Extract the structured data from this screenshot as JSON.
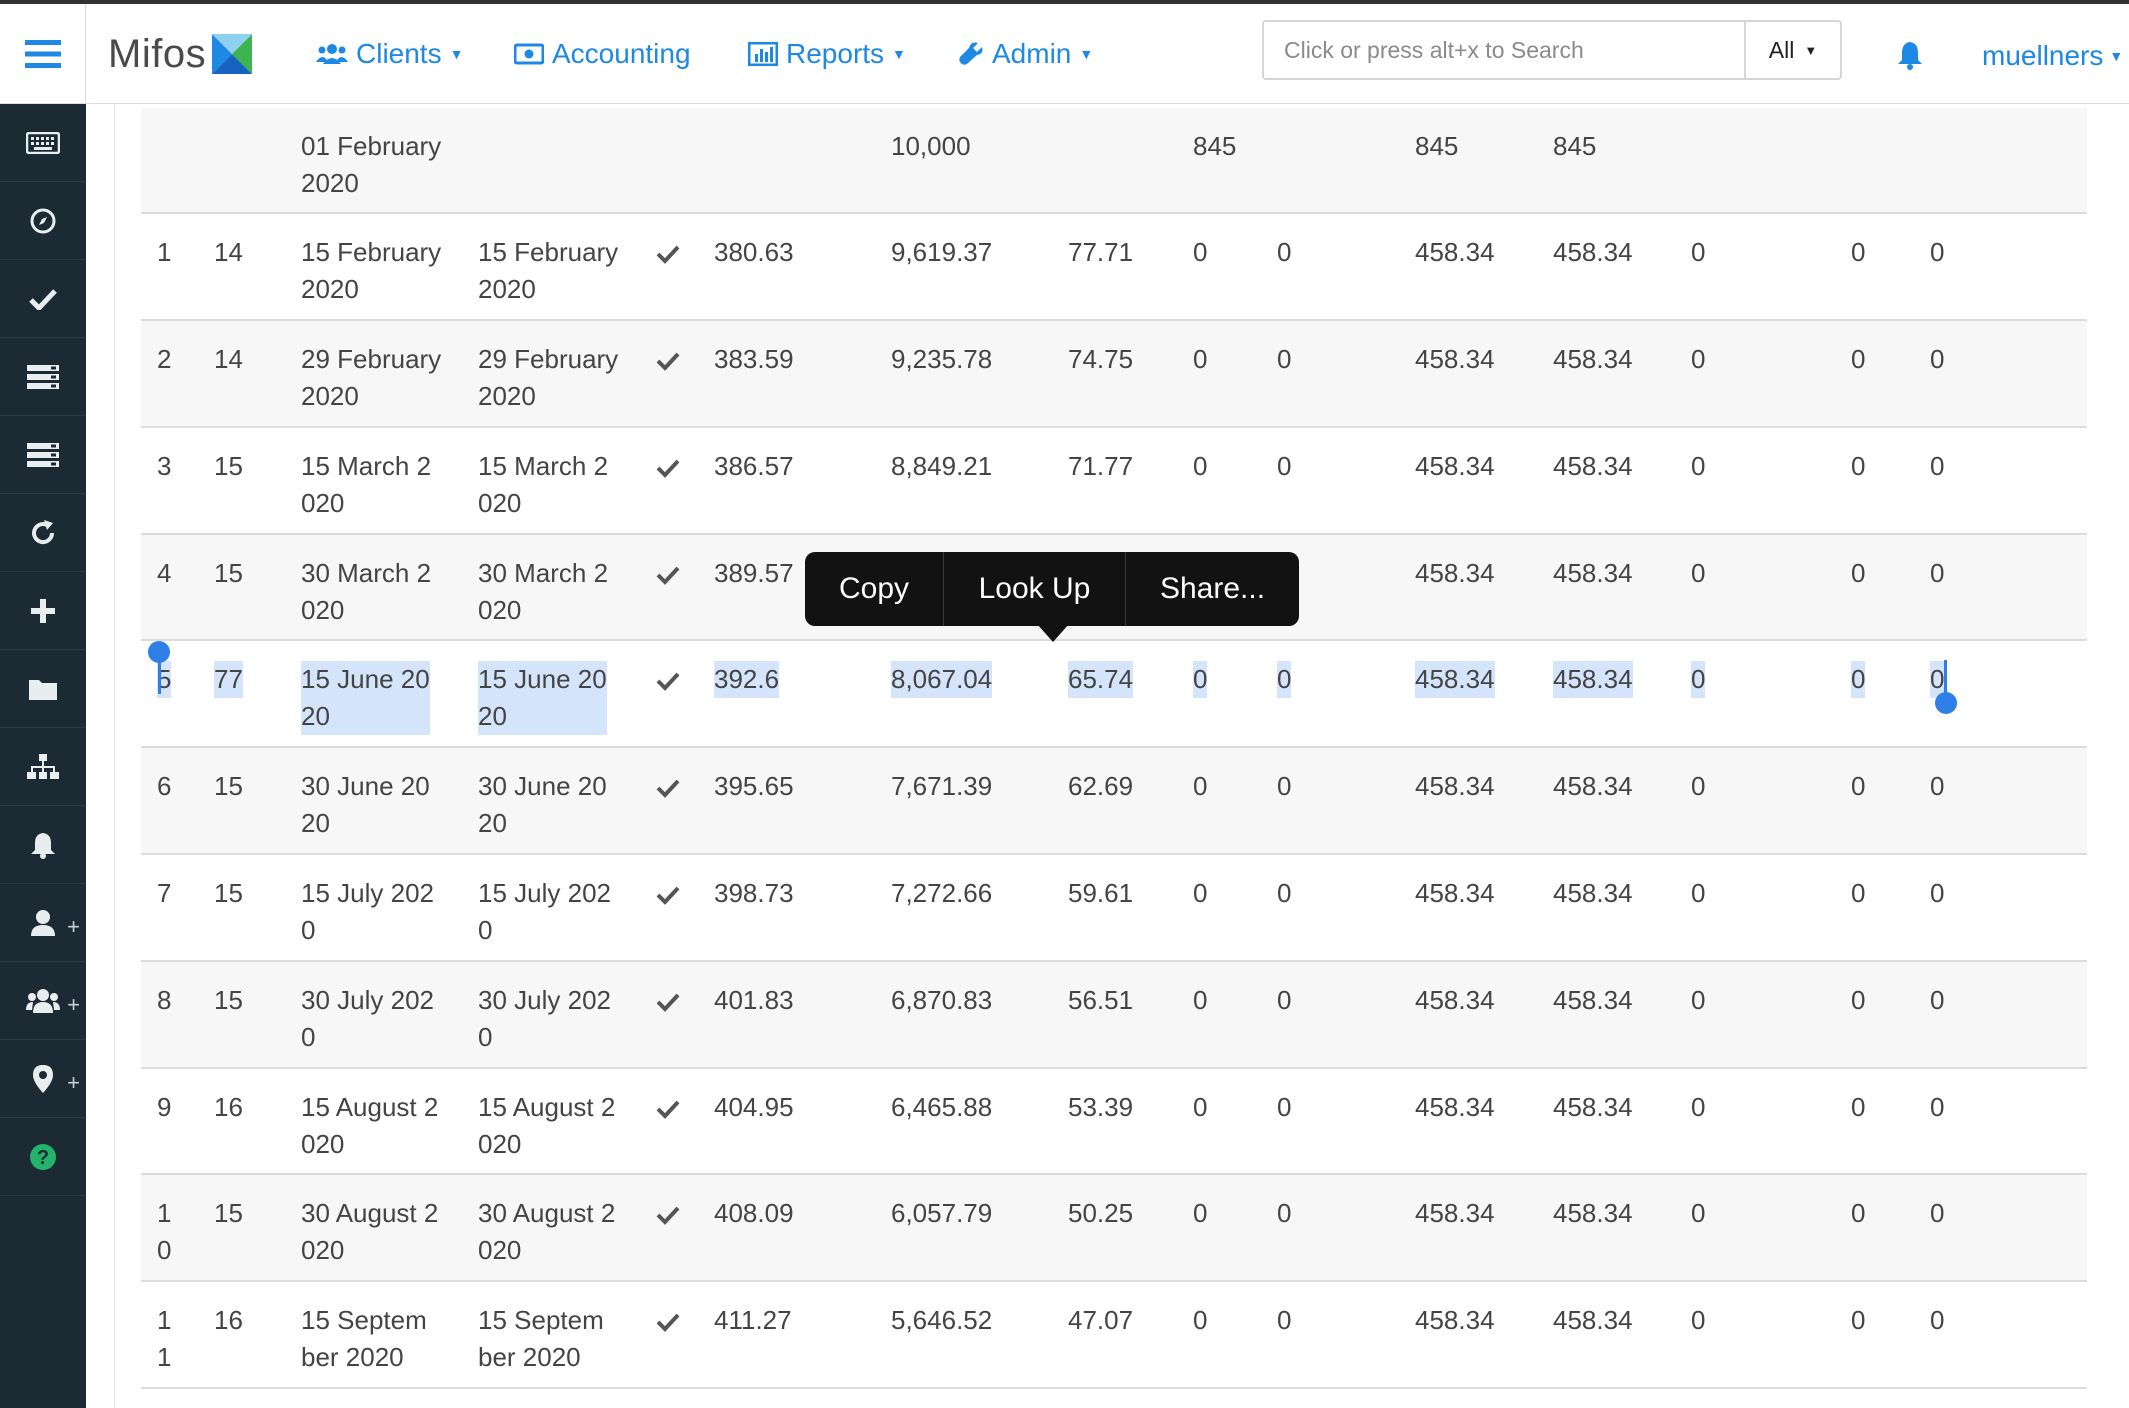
{
  "app": {
    "logo_text": "Mifos"
  },
  "nav": {
    "clients": "Clients",
    "accounting": "Accounting",
    "reports": "Reports",
    "admin": "Admin"
  },
  "search": {
    "placeholder": "Click or press alt+x to Search",
    "scope": "All"
  },
  "user": {
    "name": "muellners"
  },
  "sidebar": {
    "items": [
      "keyboard-icon",
      "compass-icon",
      "check-icon",
      "list-icon",
      "list-icon",
      "refresh-icon",
      "plus-icon",
      "folder-icon",
      "sitemap-icon",
      "bell-icon",
      "user-plus-icon",
      "users-plus-icon",
      "map-marker-plus-icon",
      "help-icon"
    ]
  },
  "context_menu": {
    "copy": "Copy",
    "look_up": "Look Up",
    "share": "Share..."
  },
  "colors": {
    "accent": "#1e88e5",
    "sidebar": "#1c2b33",
    "selection": "#d4e5fb",
    "handle": "#2f7fe8"
  },
  "rows": [
    {
      "num": "",
      "days": "",
      "date": "01 February\n2020",
      "paid_date": "",
      "paid": false,
      "principal_due": "",
      "balance": "10,000",
      "interest": "",
      "fees": "845",
      "penalties": "",
      "due": "845",
      "total": "845",
      "paid_amt": "",
      "waived": "",
      "outstanding": ""
    },
    {
      "num": "1",
      "days": "14",
      "date": "15 February\n2020",
      "paid_date": "15 February\n2020",
      "paid": true,
      "principal_due": "380.63",
      "balance": "9,619.37",
      "interest": "77.71",
      "fees": "0",
      "penalties": "0",
      "due": "458.34",
      "total": "458.34",
      "paid_amt": "0",
      "waived": "0",
      "outstanding": "0"
    },
    {
      "num": "2",
      "days": "14",
      "date": "29 February\n2020",
      "paid_date": "29 February\n2020",
      "paid": true,
      "principal_due": "383.59",
      "balance": "9,235.78",
      "interest": "74.75",
      "fees": "0",
      "penalties": "0",
      "due": "458.34",
      "total": "458.34",
      "paid_amt": "0",
      "waived": "0",
      "outstanding": "0"
    },
    {
      "num": "3",
      "days": "15",
      "date": "15 March 2\n020",
      "paid_date": "15 March 2\n020",
      "paid": true,
      "principal_due": "386.57",
      "balance": "8,849.21",
      "interest": "71.77",
      "fees": "0",
      "penalties": "0",
      "due": "458.34",
      "total": "458.34",
      "paid_amt": "0",
      "waived": "0",
      "outstanding": "0"
    },
    {
      "num": "4",
      "days": "15",
      "date": "30 March 2\n020",
      "paid_date": "30 March 2\n020",
      "paid": true,
      "principal_due": "389.57",
      "balance": "",
      "interest": "",
      "fees": "",
      "penalties": "",
      "due": "458.34",
      "total": "458.34",
      "paid_amt": "0",
      "waived": "0",
      "outstanding": "0"
    },
    {
      "num": "5",
      "days": "77",
      "date": "15 June 20\n20",
      "paid_date": "15 June 20\n20",
      "paid": true,
      "principal_due": "392.6",
      "balance": "8,067.04",
      "interest": "65.74",
      "fees": "0",
      "penalties": "0",
      "due": "458.34",
      "total": "458.34",
      "paid_amt": "0",
      "waived": "0",
      "outstanding": "0"
    },
    {
      "num": "6",
      "days": "15",
      "date": "30 June 20\n20",
      "paid_date": "30 June 20\n20",
      "paid": true,
      "principal_due": "395.65",
      "balance": "7,671.39",
      "interest": "62.69",
      "fees": "0",
      "penalties": "0",
      "due": "458.34",
      "total": "458.34",
      "paid_amt": "0",
      "waived": "0",
      "outstanding": "0"
    },
    {
      "num": "7",
      "days": "15",
      "date": "15 July 202\n0",
      "paid_date": "15 July 202\n0",
      "paid": true,
      "principal_due": "398.73",
      "balance": "7,272.66",
      "interest": "59.61",
      "fees": "0",
      "penalties": "0",
      "due": "458.34",
      "total": "458.34",
      "paid_amt": "0",
      "waived": "0",
      "outstanding": "0"
    },
    {
      "num": "8",
      "days": "15",
      "date": "30 July 202\n0",
      "paid_date": "30 July 202\n0",
      "paid": true,
      "principal_due": "401.83",
      "balance": "6,870.83",
      "interest": "56.51",
      "fees": "0",
      "penalties": "0",
      "due": "458.34",
      "total": "458.34",
      "paid_amt": "0",
      "waived": "0",
      "outstanding": "0"
    },
    {
      "num": "9",
      "days": "16",
      "date": "15 August 2\n020",
      "paid_date": "15 August 2\n020",
      "paid": true,
      "principal_due": "404.95",
      "balance": "6,465.88",
      "interest": "53.39",
      "fees": "0",
      "penalties": "0",
      "due": "458.34",
      "total": "458.34",
      "paid_amt": "0",
      "waived": "0",
      "outstanding": "0"
    },
    {
      "num": "1\n0",
      "days": "15",
      "date": "30 August 2\n020",
      "paid_date": "30 August 2\n020",
      "paid": true,
      "principal_due": "408.09",
      "balance": "6,057.79",
      "interest": "50.25",
      "fees": "0",
      "penalties": "0",
      "due": "458.34",
      "total": "458.34",
      "paid_amt": "0",
      "waived": "0",
      "outstanding": "0"
    },
    {
      "num": "1\n1",
      "days": "16",
      "date": "15 Septem\nber 2020",
      "paid_date": "15 Septem\nber 2020",
      "paid": true,
      "principal_due": "411.27",
      "balance": "5,646.52",
      "interest": "47.07",
      "fees": "0",
      "penalties": "0",
      "due": "458.34",
      "total": "458.34",
      "paid_amt": "0",
      "waived": "0",
      "outstanding": "0"
    }
  ]
}
